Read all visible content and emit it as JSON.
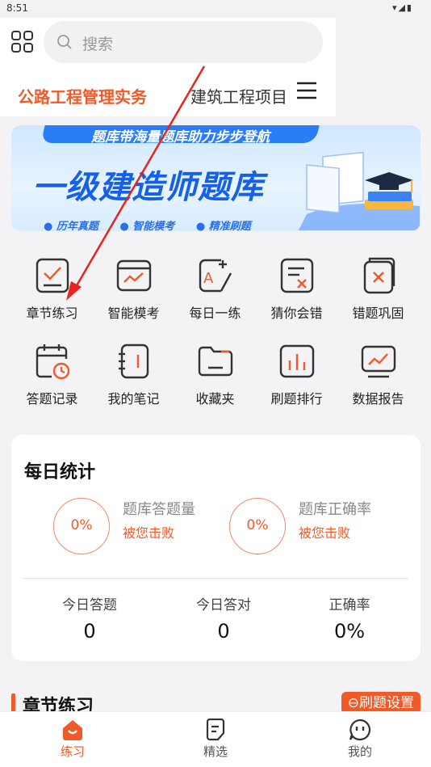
{
  "status_bar": {
    "time": "8:51"
  },
  "search": {
    "placeholder": "搜索"
  },
  "categories": {
    "active": "公路工程管理实务",
    "other": "建筑工程项目"
  },
  "banner": {
    "slogan": "题库带海量题库助力步步登航",
    "title": "一级建造师题库",
    "tags": [
      "● 历年真题",
      "● 智能模考",
      "● 精准刷题"
    ]
  },
  "tools": [
    {
      "label": "章节练习",
      "icon": "chapter-check-icon"
    },
    {
      "label": "智能模考",
      "icon": "smart-exam-icon"
    },
    {
      "label": "每日一练",
      "icon": "daily-practice-icon"
    },
    {
      "label": "猜你会错",
      "icon": "guess-wrong-icon"
    },
    {
      "label": "错题巩固",
      "icon": "wrong-review-icon"
    },
    {
      "label": "答题记录",
      "icon": "answer-record-icon"
    },
    {
      "label": "我的笔记",
      "icon": "notes-icon"
    },
    {
      "label": "收藏夹",
      "icon": "folder-icon"
    },
    {
      "label": "刷题排行",
      "icon": "ranking-icon"
    },
    {
      "label": "数据报告",
      "icon": "data-report-icon"
    }
  ],
  "daily_stats": {
    "title": "每日统计",
    "bank_count": {
      "percent": "0%",
      "label": "题库答题量",
      "sub": "被您击败"
    },
    "bank_accuracy": {
      "percent": "0%",
      "label": "题库正确率",
      "sub": "被您击败"
    },
    "today": [
      {
        "label": "今日答题",
        "value": "0"
      },
      {
        "label": "今日答对",
        "value": "0"
      },
      {
        "label": "正确率",
        "value": "0%"
      }
    ]
  },
  "section": {
    "title": "章节练习",
    "settings_label": "刷题设置"
  },
  "tabbar": [
    {
      "label": "练习",
      "icon": "practice-home-icon",
      "active": true
    },
    {
      "label": "精选",
      "icon": "featured-icon",
      "active": false
    },
    {
      "label": "我的",
      "icon": "profile-chat-icon",
      "active": false
    }
  ],
  "colors": {
    "accent": "#f05a28",
    "banner_blue": "#1560e8",
    "page_bg": "#f3f3f5"
  }
}
